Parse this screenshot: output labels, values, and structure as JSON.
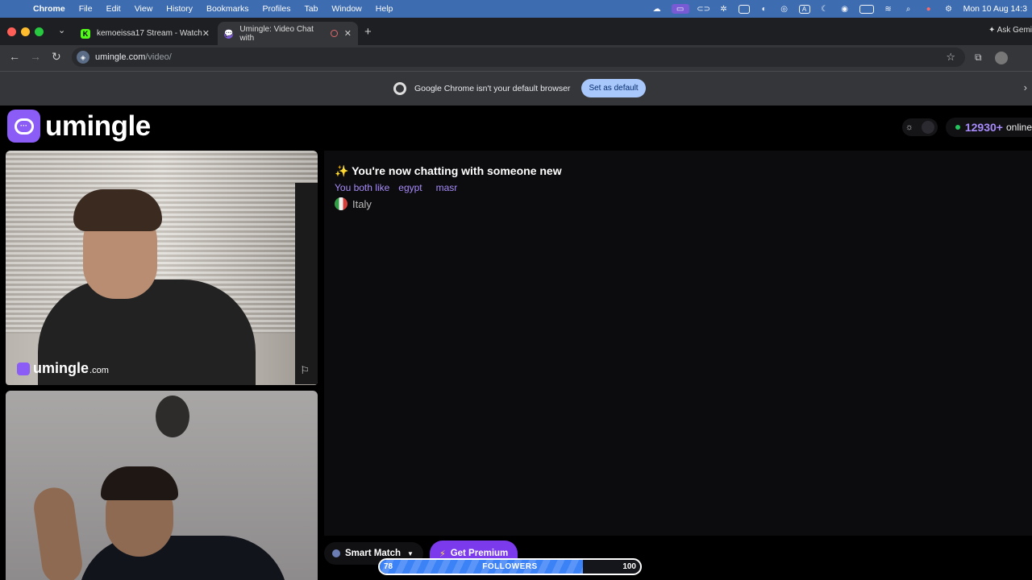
{
  "menubar": {
    "app": "Chrome",
    "items": [
      "File",
      "Edit",
      "View",
      "History",
      "Bookmarks",
      "Profiles",
      "Tab",
      "Window",
      "Help"
    ],
    "clock": "Mon 10 Aug  14:3",
    "status_icons": [
      "cloud-icon",
      "screen-record-icon",
      "link-icon",
      "chatgpt-icon",
      "window-icon",
      "globe-icon",
      "airdrop-icon",
      "keyboard-a-icon",
      "moon-icon",
      "user-icon",
      "battery-icon",
      "wifi-icon",
      "search-icon",
      "record-dot-icon",
      "control-center-icon"
    ]
  },
  "tabs": [
    {
      "favicon": "K",
      "title": "kemoeissa17 Stream - Watch",
      "active": false
    },
    {
      "favicon": "",
      "title": "Umingle: Video Chat with",
      "active": true
    }
  ],
  "ask_gemini": "Ask Gemi",
  "omnibox": {
    "host": "umingle.com",
    "path": "/video/"
  },
  "infobar": {
    "message": "Google Chrome isn't your default browser",
    "button": "Set as default"
  },
  "site": {
    "brand": "umingle",
    "online_count": "12930+",
    "online_label": "online",
    "watermark": {
      "brand": "umingle",
      "suffix": ".com"
    }
  },
  "chat": {
    "headline": "✨ You're now chatting with someone new",
    "likes_label": "You both like",
    "tags": [
      "egypt",
      "masr"
    ],
    "country": "Italy"
  },
  "controls": {
    "smart_match": "Smart Match",
    "premium": "Get Premium"
  },
  "followers_goal": {
    "label": "FOLLOWERS",
    "current": "78",
    "target": "100",
    "progress": 0.78
  },
  "colors": {
    "accent": "#8b5cf6",
    "online_dot": "#22c55e",
    "progress": "#3b82f6"
  }
}
